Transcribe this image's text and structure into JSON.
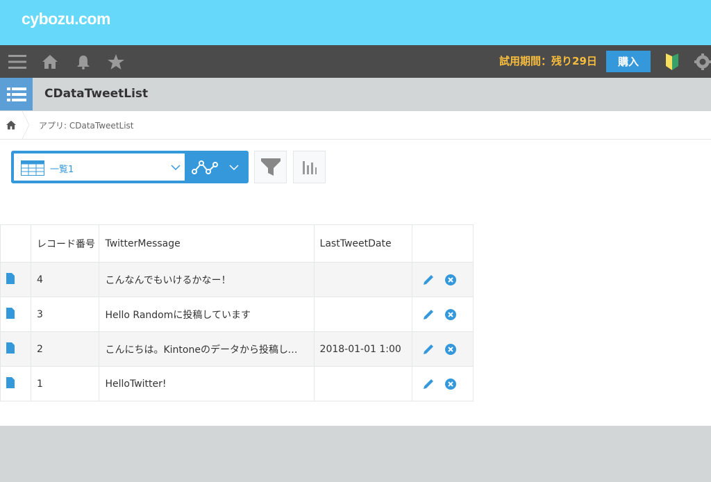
{
  "brand": {
    "name": "cybozu.com"
  },
  "nav": {
    "icons": [
      "menu-icon",
      "home-icon",
      "bell-icon",
      "star-icon",
      "beginner-mark-icon",
      "gear-icon"
    ],
    "trial_text": "試用期間：残り29日",
    "buy_label": "購入"
  },
  "app": {
    "title": "CDataTweetList",
    "breadcrumb": "アプリ: CDataTweetList"
  },
  "toolbar": {
    "view_label": "一覧1"
  },
  "table": {
    "headers": [
      "",
      "レコード番号",
      "TwitterMessage",
      "LastTweetDate",
      ""
    ],
    "rows": [
      {
        "id": "4",
        "message": "こんなんでもいけるかなー！",
        "date": ""
      },
      {
        "id": "3",
        "message": "Hello Randomに投稿しています",
        "date": ""
      },
      {
        "id": "2",
        "message": "こんにちは。Kintoneのデータから投稿しています",
        "date": "2018-01-01 1:00"
      },
      {
        "id": "1",
        "message": "HelloTwitter!",
        "date": ""
      }
    ]
  },
  "colors": {
    "brand_bar": "#66d9fa",
    "nav_bar": "#4b4b4b",
    "accent": "#3498db",
    "trial_text": "#f9bd3d"
  }
}
